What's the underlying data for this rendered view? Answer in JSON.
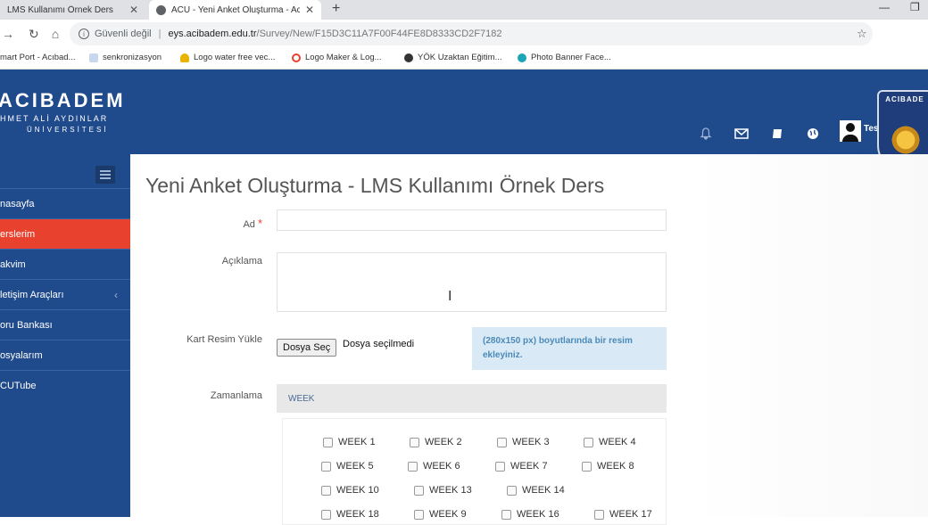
{
  "browser": {
    "tabs": [
      {
        "title": "LMS Kullanımı Örnek Ders",
        "close": "✕"
      },
      {
        "title": "ACU - Yeni Anket Oluşturma - Ac",
        "close": "✕"
      }
    ],
    "new_tab": "+",
    "window_controls": {
      "minimize": "—",
      "restore": "❐"
    },
    "address": {
      "security_label": "Güvenli değil",
      "host": "eys.acibadem.edu.tr",
      "path": "/Survey/New/F15D3C11A7F00F44FE8D8333CD2F7182"
    },
    "nav": {
      "back": "→",
      "reload": "↻",
      "home": "⌂"
    },
    "star": "☆",
    "bookmarks": [
      {
        "label": "mart Port - Acıbad...",
        "icon": "page-icon"
      },
      {
        "label": "senkronizasyon",
        "icon": "doc-icon"
      },
      {
        "label": "Logo water free vec...",
        "icon": "bulb-icon"
      },
      {
        "label": "Logo Maker & Log...",
        "icon": "circle-icon"
      },
      {
        "label": "YÖK Uzaktan Eğitim...",
        "icon": "globe-icon"
      },
      {
        "label": "Photo Banner Face...",
        "icon": "c-icon"
      }
    ]
  },
  "header": {
    "brand": "ACIBADEM",
    "brand_line2": "HMET ALİ AYDINLAR",
    "brand_line3": "ÜNİVERSİTESİ",
    "crest_text": "ACIBADE",
    "user": "Test Eğitmen",
    "icons": [
      "bell-icon",
      "mail-icon",
      "book-icon",
      "globe-icon"
    ]
  },
  "sidebar": {
    "items": [
      {
        "label": "nasayfa",
        "active": false
      },
      {
        "label": "erslerim",
        "active": true
      },
      {
        "label": "akvim",
        "active": false
      },
      {
        "label": "letişim Araçları",
        "active": false,
        "chevron": "‹"
      },
      {
        "label": "oru Bankası",
        "active": false
      },
      {
        "label": "osyalarım",
        "active": false
      },
      {
        "label": "CUTube",
        "active": false
      }
    ]
  },
  "form": {
    "title": "Yeni Anket Oluşturma - LMS Kullanımı Örnek Ders",
    "name_label": "Ad",
    "required_mark": "*",
    "description_label": "Açıklama",
    "image_label": "Kart Resim Yükle",
    "file_button": "Dosya Seç",
    "file_status": "Dosya seçilmedi",
    "image_hint": "(280x150 px) boyutlarında bir resim ekleyiniz.",
    "schedule_label": "Zamanlama",
    "week_header": "WEEK",
    "weeks": [
      "WEEK 1",
      "WEEK 2",
      "WEEK 3",
      "WEEK 4",
      "WEEK 5",
      "WEEK 6",
      "WEEK 7",
      "WEEK 8",
      "WEEK 10",
      "WEEK 13",
      "WEEK 14",
      "WEEK 18",
      "WEEK 9",
      "WEEK 16",
      "WEEK 17"
    ]
  },
  "colors": {
    "primary": "#1f4a8c",
    "active": "#e8412e",
    "hint_bg": "#d9eaf6"
  }
}
